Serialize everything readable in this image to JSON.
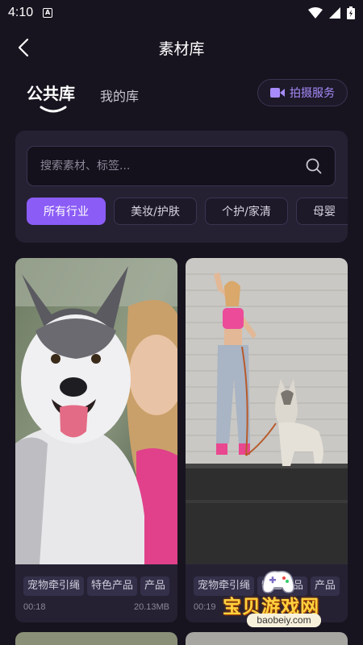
{
  "status_bar": {
    "time": "4:10",
    "notification_icon": "A"
  },
  "header": {
    "title": "素材库",
    "back_icon": "chevron-left-icon"
  },
  "library_tabs": {
    "public": "公共库",
    "mine": "我的库"
  },
  "shoot_service": {
    "label": "拍摄服务",
    "icon": "video-camera-icon",
    "color": "#a78bfa"
  },
  "search": {
    "placeholder": "搜索素材、标签...",
    "value": ""
  },
  "categories": [
    {
      "label": "所有行业",
      "active": true
    },
    {
      "label": "美妆/护肤",
      "active": false
    },
    {
      "label": "个护/家清",
      "active": false
    },
    {
      "label": "母婴",
      "active": false
    }
  ],
  "cards": [
    {
      "subject": "husky dog and woman",
      "tags": [
        "宠物牵引绳",
        "特色产品",
        "产品"
      ],
      "duration": "00:18",
      "size": "20.13MB"
    },
    {
      "subject": "woman walking husky on leash",
      "tags": [
        "宠物牵引绳",
        "特色产品",
        "产品"
      ],
      "duration": "00:19",
      "size": ""
    }
  ],
  "watermark": {
    "text": "宝贝游戏网",
    "url": "baobeiy.com"
  },
  "colors": {
    "background": "#17141f",
    "card": "#252133",
    "accent": "#8b5cf6"
  }
}
